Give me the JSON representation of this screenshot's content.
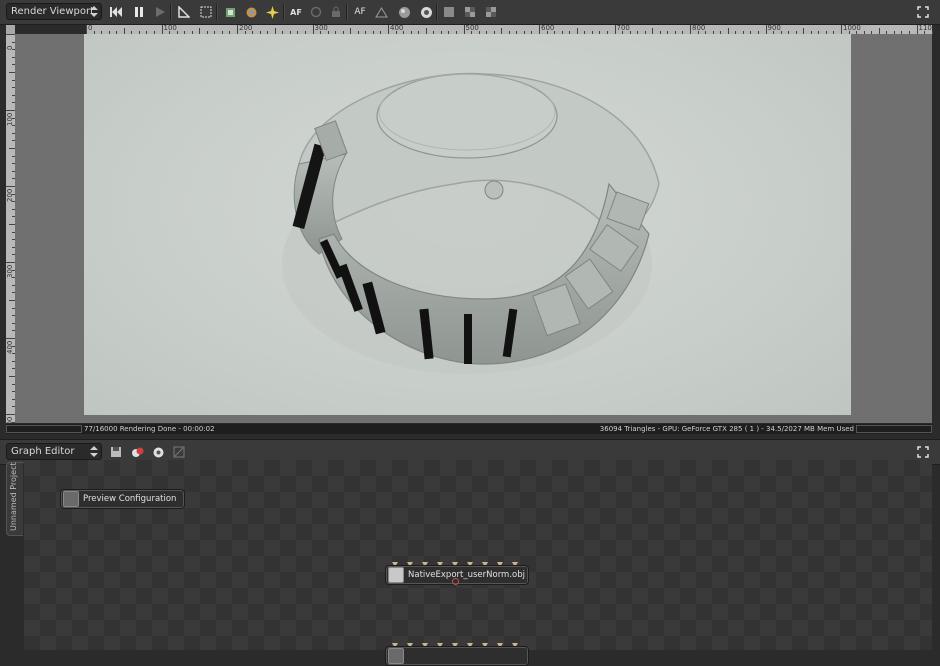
{
  "top_toolbar": {
    "view_select": "Render Viewport",
    "buttons": [
      "rewind-icon",
      "pause-icon",
      "play-icon",
      "ruler-icon",
      "region-icon",
      "export-icon",
      "material-icon",
      "light-icon",
      "af-label",
      "refresh-icon",
      "lock-icon",
      "af-text",
      "sphere-icon",
      "camera-icon",
      "texture-icon",
      "checker-icon",
      "fill-icon",
      "alpha-icon"
    ],
    "af_label": "AF",
    "maximize": "fullscreen-icon"
  },
  "ruler": {
    "h_labels": [
      "0",
      "100",
      "200",
      "300",
      "400",
      "500",
      "600",
      "700",
      "800",
      "900",
      "1000",
      "1100"
    ],
    "v_labels": [
      "0",
      "100",
      "200",
      "300",
      "400",
      "500"
    ]
  },
  "status_bar": {
    "left": "77/16000 Rendering Done - 00:00:02",
    "right": "36094 Triangles - GPU: GeForce GTX 285 ( 1 ) - 34.5/2027 MB Mem Used"
  },
  "graph_toolbar": {
    "view_select": "Graph Editor",
    "maximize": "fullscreen-icon"
  },
  "graph": {
    "project_tab": "Unnamed Project",
    "nodes": [
      {
        "label": "Preview Configuration"
      },
      {
        "label": "NativeExport_userNorm.obj"
      },
      {
        "label": ""
      }
    ]
  }
}
